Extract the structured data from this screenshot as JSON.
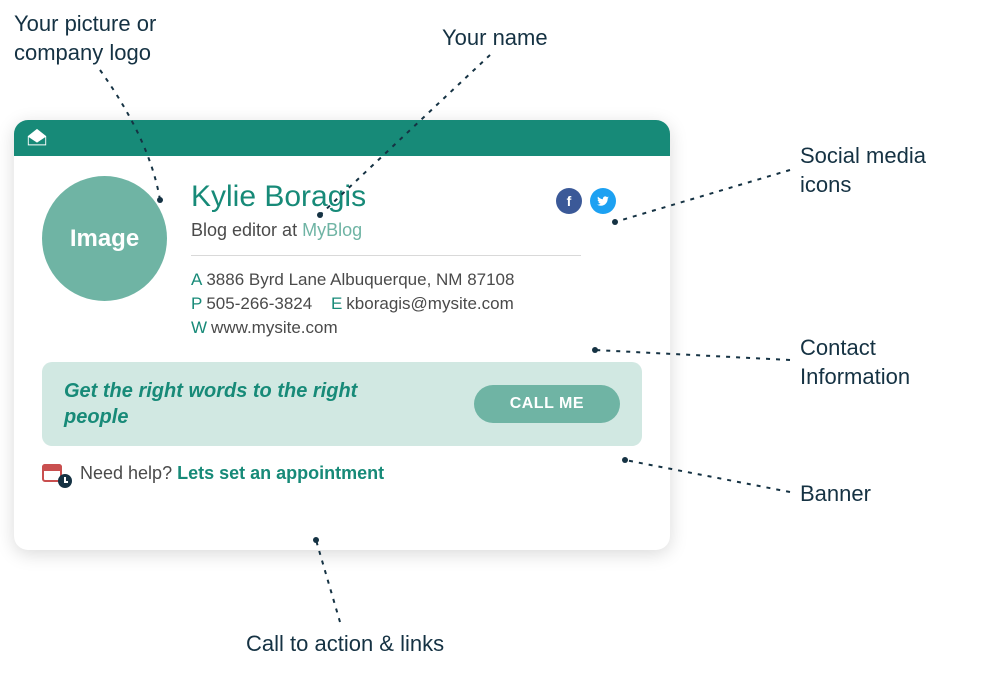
{
  "annotations": {
    "logo": "Your picture or\ncompany logo",
    "name": "Your name",
    "social": "Social media\nicons",
    "contact": "Contact\nInformation",
    "banner": "Banner",
    "cta": "Call to action & links"
  },
  "card": {
    "avatar_label": "Image",
    "name": "Kylie Boragis",
    "title_prefix": "Blog editor at ",
    "company": "MyBlog",
    "address_key": "A",
    "address": "3886 Byrd Lane Albuquerque, NM 87108",
    "phone_key": "P",
    "phone": "505-266-3824",
    "email_key": "E",
    "email": "kboragis@mysite.com",
    "web_key": "W",
    "web": "www.mysite.com",
    "banner_text": "Get the right words to the right people",
    "call_label": "CALL ME",
    "cta_question": "Need help? ",
    "cta_link": "Lets set an appointment",
    "socials": {
      "facebook": "f",
      "twitter": "t"
    }
  }
}
